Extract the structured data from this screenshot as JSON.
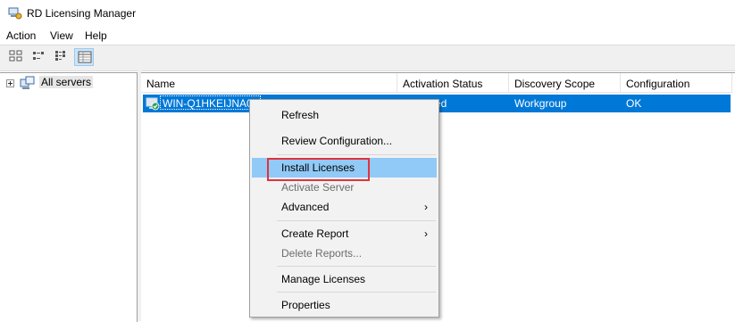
{
  "window": {
    "title": "RD Licensing Manager"
  },
  "menubar": {
    "items": [
      {
        "label": "Action"
      },
      {
        "label": "View"
      },
      {
        "label": "Help"
      }
    ]
  },
  "toolbar": {
    "buttons": [
      {
        "icon": "large-icons-view-icon"
      },
      {
        "icon": "small-icons-view-icon"
      },
      {
        "icon": "list-view-icon"
      },
      {
        "icon": "details-view-icon",
        "active": true
      }
    ]
  },
  "tree": {
    "root_label": "All servers"
  },
  "table": {
    "columns": [
      "Name",
      "Activation Status",
      "Discovery Scope",
      "Configuration"
    ],
    "rows": [
      {
        "name": "WIN-Q1HKEIJNA0L",
        "activation": "Activated",
        "scope": "Workgroup",
        "configuration": "OK",
        "selected": true
      }
    ]
  },
  "context_menu": {
    "items": [
      {
        "label": "Refresh",
        "enabled": true
      },
      {
        "label": "Review Configuration...",
        "enabled": true
      },
      {
        "label": "Install Licenses",
        "enabled": true,
        "highlighted": true
      },
      {
        "label": "Activate Server",
        "enabled": false
      },
      {
        "label": "Advanced",
        "enabled": true,
        "submenu": true
      },
      {
        "label": "Create Report",
        "enabled": true,
        "submenu": true
      },
      {
        "label": "Delete Reports...",
        "enabled": false
      },
      {
        "label": "Manage Licenses",
        "enabled": true
      },
      {
        "label": "Properties",
        "enabled": true
      }
    ]
  },
  "colors": {
    "selection": "#0078d7",
    "menu_hover": "#91c9f7",
    "annotation_box": "#e0333c"
  }
}
